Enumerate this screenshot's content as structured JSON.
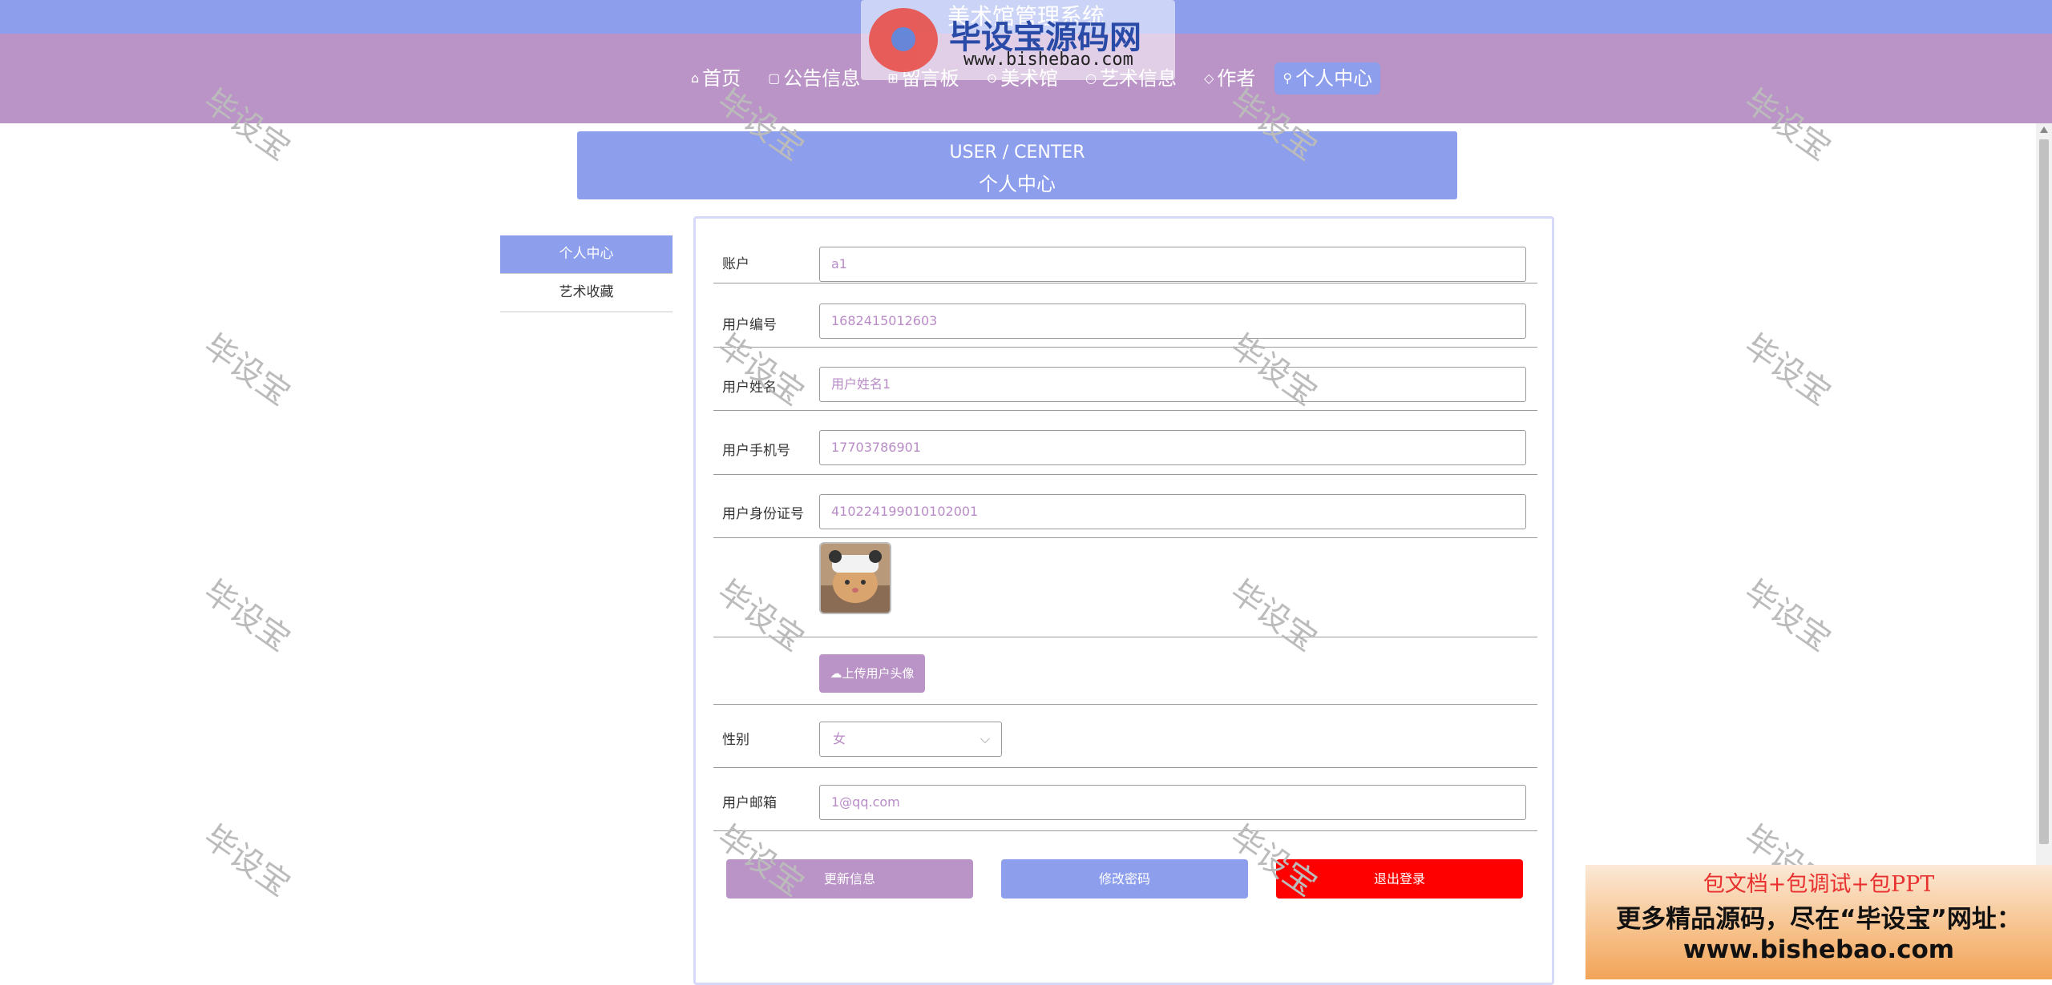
{
  "site": {
    "title": "美术馆管理系统"
  },
  "nav": {
    "items": [
      {
        "label": "首页",
        "icon": "⌂"
      },
      {
        "label": "公告信息",
        "icon": "▢"
      },
      {
        "label": "留言板",
        "icon": "⊞"
      },
      {
        "label": "美术馆",
        "icon": "⊙"
      },
      {
        "label": "艺术信息",
        "icon": "○"
      },
      {
        "label": "作者",
        "icon": "◇"
      },
      {
        "label": "个人中心",
        "icon": "⚲"
      }
    ],
    "active_index": 6
  },
  "banner": {
    "en": "USER / CENTER",
    "cn": "个人中心"
  },
  "sidebar": {
    "items": [
      {
        "label": "个人中心"
      },
      {
        "label": "艺术收藏"
      }
    ]
  },
  "form": {
    "account": {
      "label": "账户",
      "value": "a1"
    },
    "user_no": {
      "label": "用户编号",
      "value": "1682415012603"
    },
    "user_name": {
      "label": "用户姓名",
      "value": "用户姓名1"
    },
    "phone": {
      "label": "用户手机号",
      "value": "17703786901"
    },
    "id_card": {
      "label": "用户身份证号",
      "value": "410224199010102001"
    },
    "upload_label": "上传用户头像",
    "gender": {
      "label": "性别",
      "value": "女"
    },
    "email": {
      "label": "用户邮箱",
      "value": "1@qq.com"
    },
    "buttons": {
      "update": "更新信息",
      "change_password": "修改密码",
      "logout": "退出登录"
    }
  },
  "watermark": {
    "logo_text": "毕设宝源码网",
    "logo_url": "www.bishebao.com",
    "text": "毕设宝"
  },
  "ad": {
    "line1": "包文档+包调试+包PPT",
    "line2": "更多精品源码，尽在“毕设宝”网址：",
    "line3": "www.bishebao.com"
  },
  "colors": {
    "top_bar": "#8c9eec",
    "nav_bar": "#bb94c7",
    "accent": "#8c9eec",
    "update_button": "#bb94c7",
    "logout_button": "#ff0000"
  },
  "icons": {
    "upload": "cloud-upload-icon",
    "select": "chevron-down-icon"
  }
}
